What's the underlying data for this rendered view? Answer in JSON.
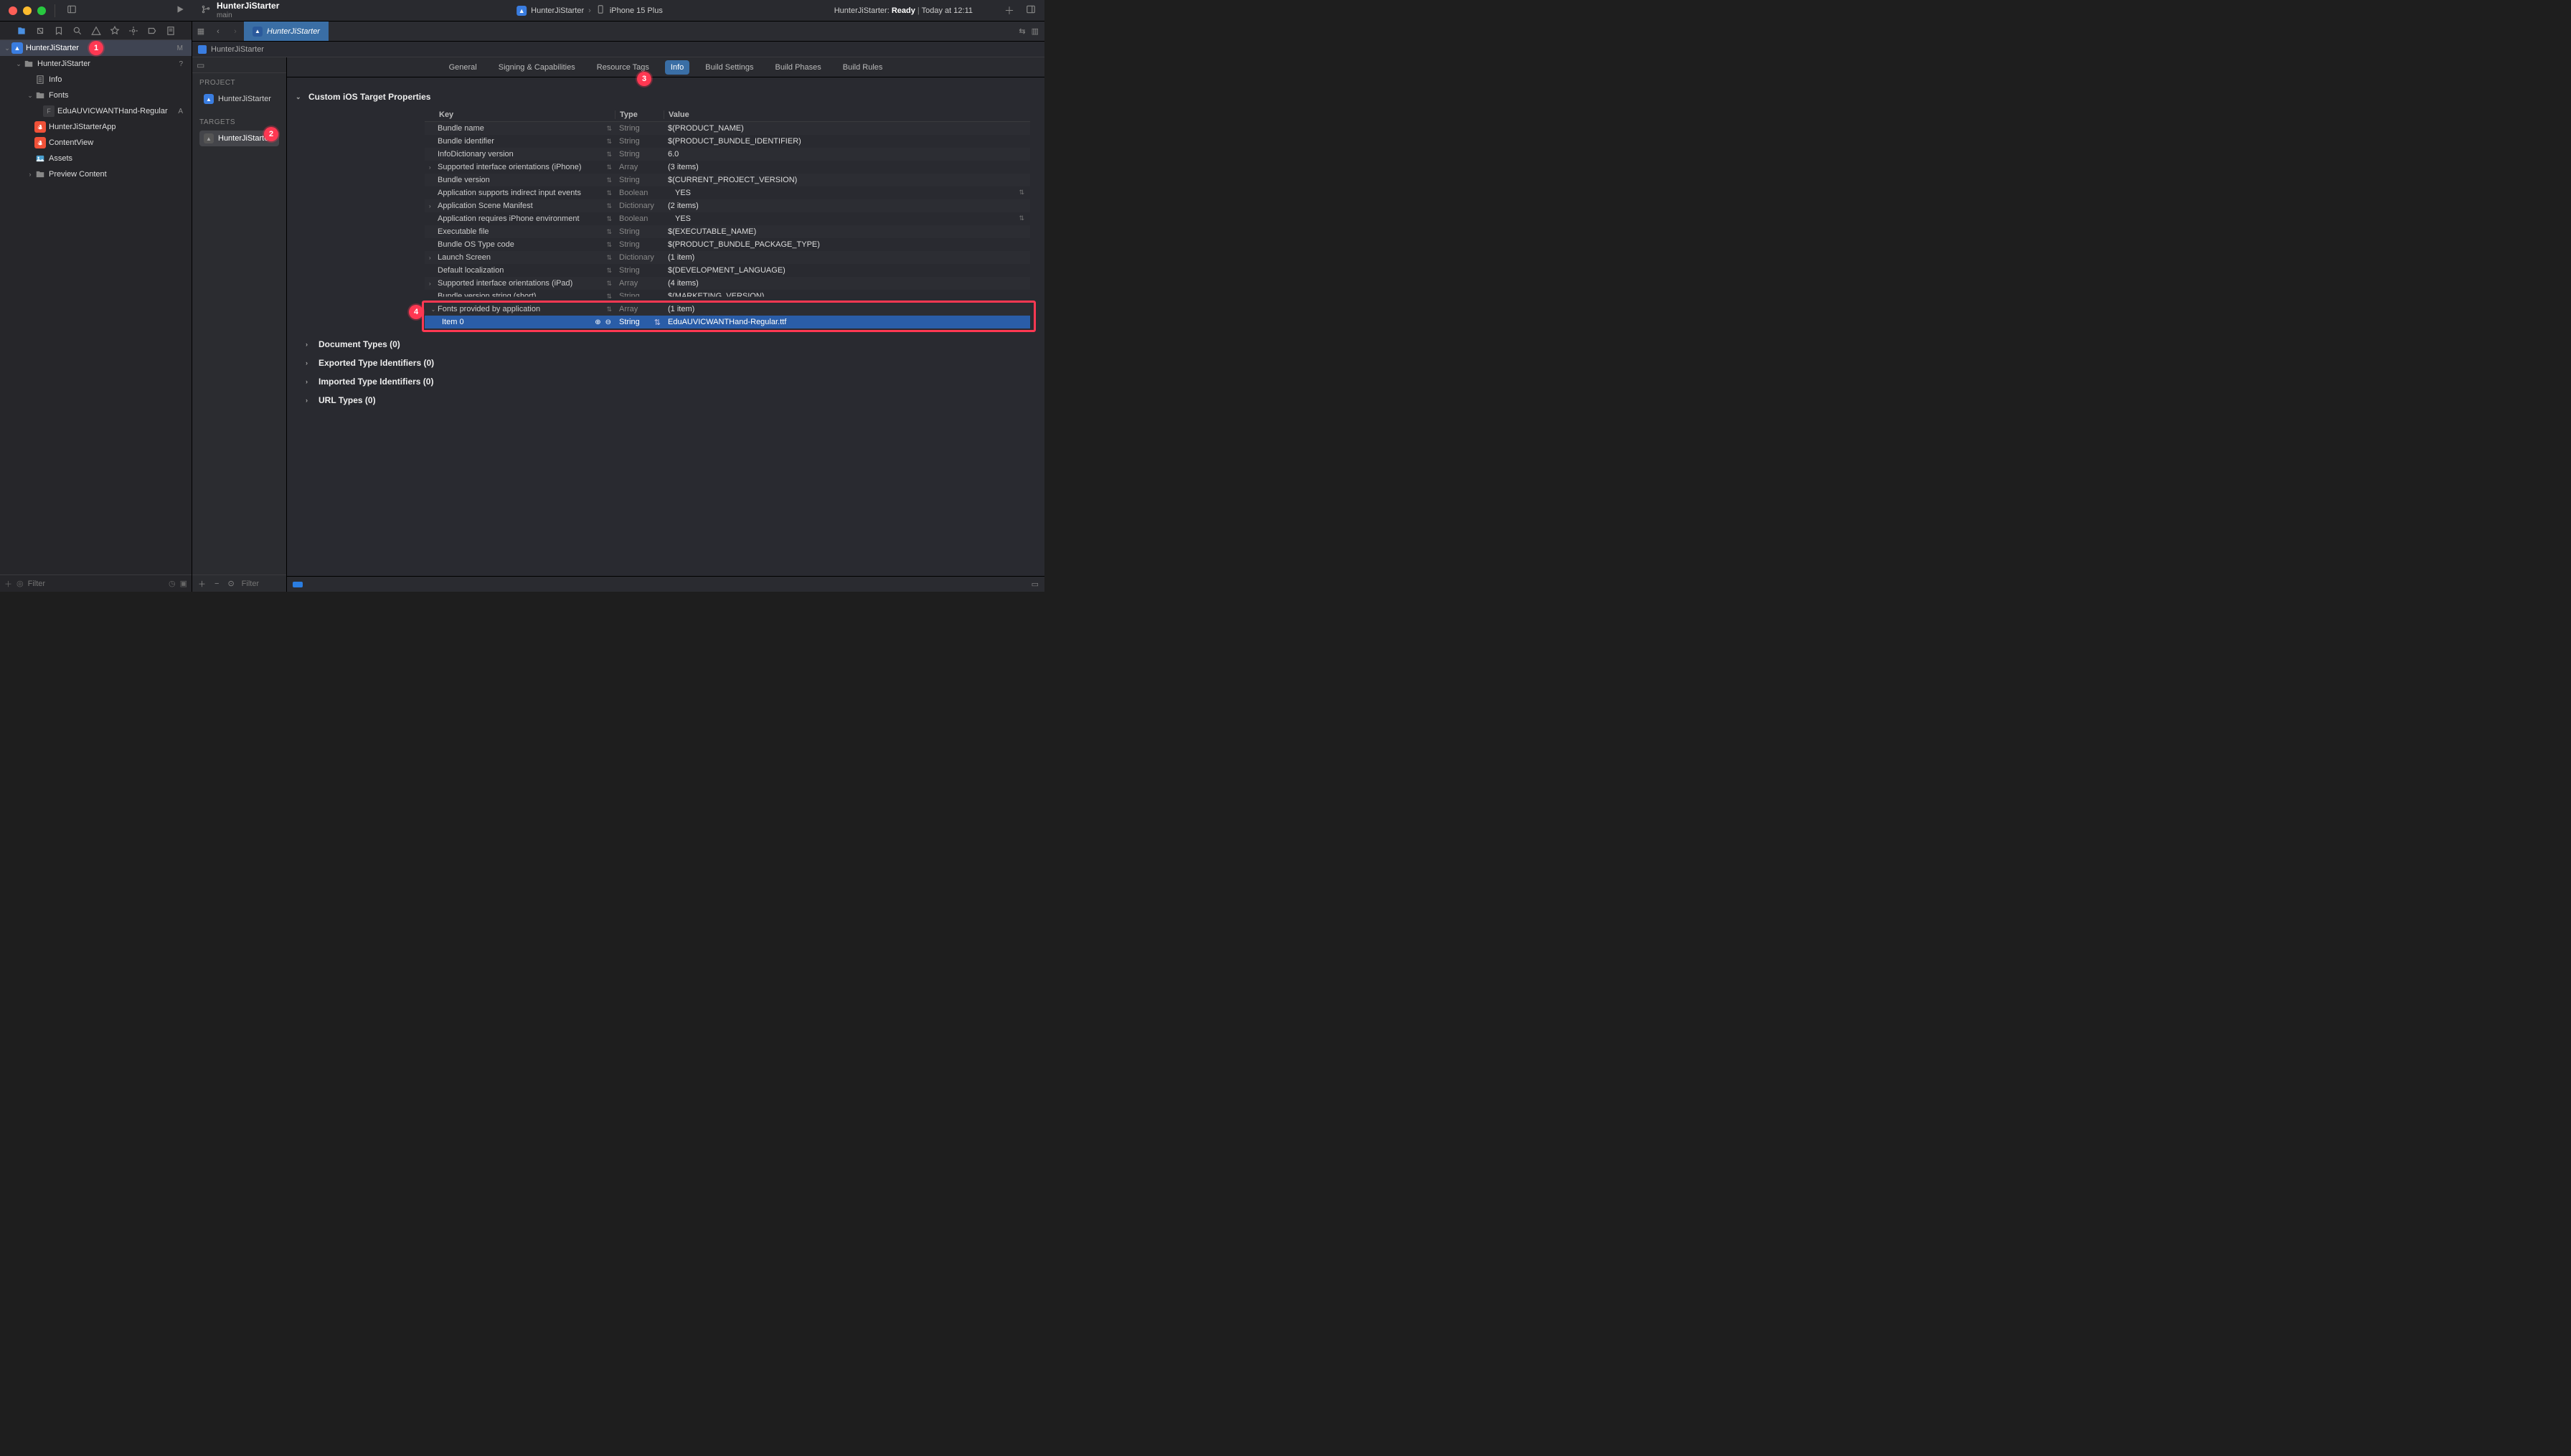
{
  "titlebar": {
    "project_name": "HunterJiStarter",
    "branch": "main",
    "scheme": "HunterJiStarter",
    "destination": "iPhone 15 Plus",
    "status_prefix": "HunterJiStarter:",
    "status_state": "Ready",
    "status_time": "Today at 12:11"
  },
  "navigator": {
    "root": {
      "label": "HunterJiStarter",
      "badge": "M"
    },
    "group": {
      "label": "HunterJiStarter",
      "help_badge": "?"
    },
    "items": {
      "info": "Info",
      "fonts": "Fonts",
      "font_file": "EduAUVICWANTHand-Regular",
      "font_badge": "A",
      "app": "HunterJiStarterApp",
      "contentview": "ContentView",
      "assets": "Assets",
      "preview": "Preview Content"
    },
    "filter_placeholder": "Filter"
  },
  "tabbar": {
    "tab_label": "HunterJiStarter"
  },
  "breadcrumb": {
    "path": "HunterJiStarter"
  },
  "targets_pane": {
    "project_label": "PROJECT",
    "project_item": "HunterJiStarter",
    "targets_label": "TARGETS",
    "target_item": "HunterJiStarter",
    "filter_placeholder": "Filter"
  },
  "settings_tabs": {
    "general": "General",
    "signing": "Signing & Capabilities",
    "resource": "Resource Tags",
    "info": "Info",
    "build_settings": "Build Settings",
    "build_phases": "Build Phases",
    "build_rules": "Build Rules"
  },
  "sections": {
    "custom_props": "Custom iOS Target Properties",
    "document_types": "Document Types (0)",
    "exported_uti": "Exported Type Identifiers (0)",
    "imported_uti": "Imported Type Identifiers (0)",
    "url_types": "URL Types (0)"
  },
  "plist_header": {
    "key": "Key",
    "type": "Type",
    "value": "Value"
  },
  "plist_rows": [
    {
      "key": "Bundle name",
      "type": "String",
      "value": "$(PRODUCT_NAME)",
      "expandable": false,
      "indent": 0
    },
    {
      "key": "Bundle identifier",
      "type": "String",
      "value": "$(PRODUCT_BUNDLE_IDENTIFIER)",
      "expandable": false,
      "indent": 0
    },
    {
      "key": "InfoDictionary version",
      "type": "String",
      "value": "6.0",
      "expandable": false,
      "indent": 0
    },
    {
      "key": "Supported interface orientations (iPhone)",
      "type": "Array",
      "value": "(3 items)",
      "expandable": true,
      "indent": 0
    },
    {
      "key": "Bundle version",
      "type": "String",
      "value": "$(CURRENT_PROJECT_VERSION)",
      "expandable": false,
      "indent": 0
    },
    {
      "key": "Application supports indirect input events",
      "type": "Boolean",
      "value": "YES",
      "expandable": false,
      "indent": 0,
      "value_chooser": true
    },
    {
      "key": "Application Scene Manifest",
      "type": "Dictionary",
      "value": "(2 items)",
      "expandable": true,
      "indent": 0
    },
    {
      "key": "Application requires iPhone environment",
      "type": "Boolean",
      "value": "YES",
      "expandable": false,
      "indent": 0,
      "value_chooser": true
    },
    {
      "key": "Executable file",
      "type": "String",
      "value": "$(EXECUTABLE_NAME)",
      "expandable": false,
      "indent": 0
    },
    {
      "key": "Bundle OS Type code",
      "type": "String",
      "value": "$(PRODUCT_BUNDLE_PACKAGE_TYPE)",
      "expandable": false,
      "indent": 0
    },
    {
      "key": "Launch Screen",
      "type": "Dictionary",
      "value": "(1 item)",
      "expandable": true,
      "indent": 0
    },
    {
      "key": "Default localization",
      "type": "String",
      "value": "$(DEVELOPMENT_LANGUAGE)",
      "expandable": false,
      "indent": 0
    },
    {
      "key": "Supported interface orientations (iPad)",
      "type": "Array",
      "value": "(4 items)",
      "expandable": true,
      "indent": 0
    },
    {
      "key": "Bundle version string (short)",
      "type": "String",
      "value": "$(MARKETING_VERSION)",
      "expandable": false,
      "indent": 0,
      "cutoff": true
    }
  ],
  "plist_highlight": {
    "parent": {
      "key": "Fonts provided by application",
      "type": "Array",
      "value": "(1 item)",
      "expandable": true,
      "expanded": true,
      "indent": 0
    },
    "child": {
      "key": "Item 0",
      "type": "String",
      "value": "EduAUVICWANTHand-Regular.ttf",
      "indent": 1,
      "selected": true,
      "show_pm": true
    }
  },
  "annotations": {
    "b1": "1",
    "b2": "2",
    "b3": "3",
    "b4": "4"
  }
}
